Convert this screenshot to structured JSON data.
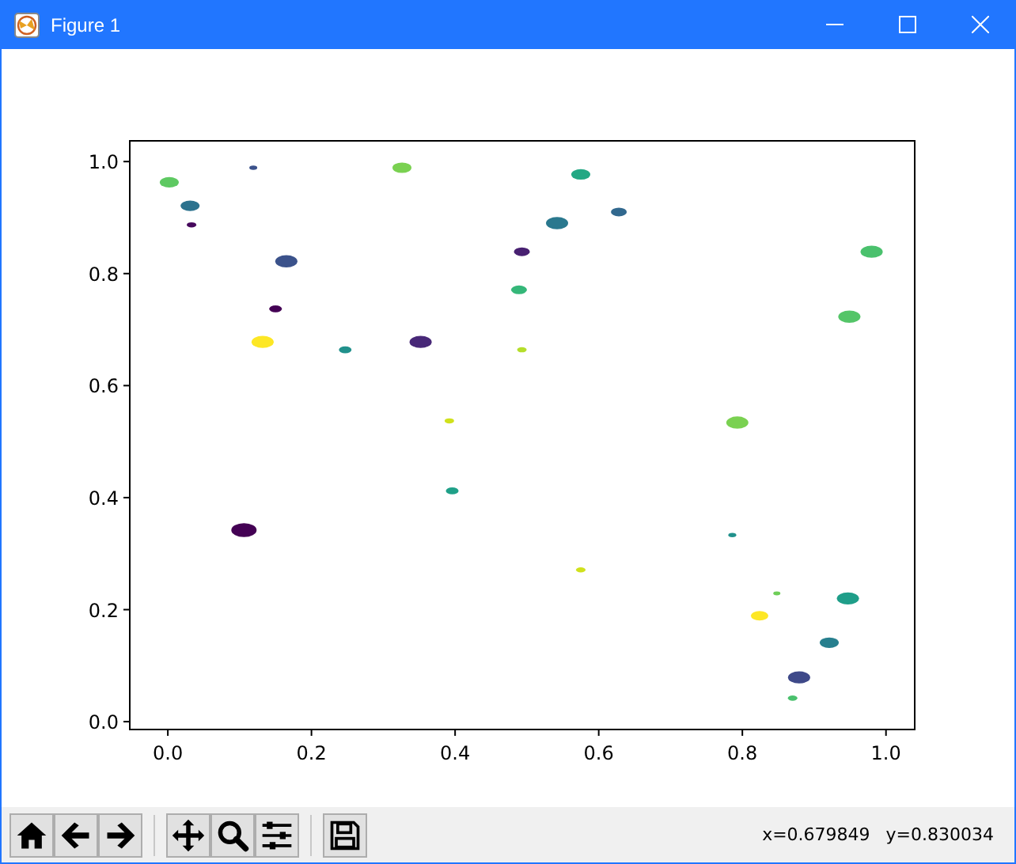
{
  "window": {
    "title": "Figure 1"
  },
  "chart_data": {
    "type": "scatter",
    "xlim": [
      -0.053,
      1.04
    ],
    "ylim": [
      -0.014,
      1.037
    ],
    "xticks": [
      {
        "value": 0,
        "label": "0.0"
      },
      {
        "value": 0.2,
        "label": "0.2"
      },
      {
        "value": 0.4,
        "label": "0.4"
      },
      {
        "value": 0.6,
        "label": "0.6"
      },
      {
        "value": 0.8,
        "label": "0.8"
      },
      {
        "value": 1,
        "label": "1.0"
      }
    ],
    "yticks": [
      {
        "value": 0,
        "label": "0.0"
      },
      {
        "value": 0.2,
        "label": "0.2"
      },
      {
        "value": 0.4,
        "label": "0.4"
      },
      {
        "value": 0.6,
        "label": "0.6"
      },
      {
        "value": 0.8,
        "label": "0.8"
      },
      {
        "value": 1,
        "label": "1.0"
      }
    ],
    "x": [
      0.002,
      0.031,
      0.033,
      0.119,
      0.165,
      0.15,
      0.132,
      0.247,
      0.326,
      0.352,
      0.392,
      0.396,
      0.106,
      0.575,
      0.542,
      0.628,
      0.493,
      0.489,
      0.493,
      0.793,
      0.98,
      0.949,
      0.575,
      0.786,
      0.848,
      0.824,
      0.947,
      0.921,
      0.879,
      0.87
    ],
    "series": [
      {
        "values": [
          0.963,
          0.921,
          0.887,
          0.989,
          0.822,
          0.737,
          0.678,
          0.664,
          0.989,
          0.678,
          0.537,
          0.412,
          0.342,
          0.977,
          0.89,
          0.91,
          0.839,
          0.771,
          0.664,
          0.534,
          0.839,
          0.723,
          0.271,
          0.333,
          0.229,
          0.189,
          0.22,
          0.141,
          0.079,
          0.042
        ],
        "colors": [
          "#5ec962",
          "#2c728e",
          "#46085c",
          "#3b528b",
          "#3b528b",
          "#440154",
          "#fde725",
          "#21918c",
          "#7ad151",
          "#482878",
          "#d0e11c",
          "#1fa088",
          "#440154",
          "#22a884",
          "#2a788e",
          "#31688e",
          "#482071",
          "#35b779",
          "#b5de2b",
          "#7ad151",
          "#4ac16d",
          "#54c568",
          "#d0e11c",
          "#21918c",
          "#6ece58",
          "#fde725",
          "#1f9e89",
          "#277f8e",
          "#3e4989",
          "#4ac16d"
        ],
        "sizes": [
          0.563,
          0.563,
          0.141,
          0.098,
          0.766,
          0.25,
          0.766,
          0.25,
          0.563,
          0.766,
          0.141,
          0.25,
          1,
          0.563,
          0.766,
          0.391,
          0.391,
          0.391,
          0.141,
          0.766,
          0.766,
          0.766,
          0.141,
          0.098,
          0.08,
          0.473,
          0.766,
          0.563,
          0.766,
          0.141
        ]
      }
    ]
  },
  "toolbar": {
    "buttons": [
      {
        "kind": "home"
      },
      {
        "kind": "back"
      },
      {
        "kind": "forward"
      },
      {
        "kind": "separator"
      },
      {
        "kind": "pan"
      },
      {
        "kind": "zoom"
      },
      {
        "kind": "configure"
      },
      {
        "kind": "separator"
      },
      {
        "kind": "save"
      }
    ],
    "coordinates": [
      "x=0.679849",
      "y=0.830034"
    ]
  }
}
